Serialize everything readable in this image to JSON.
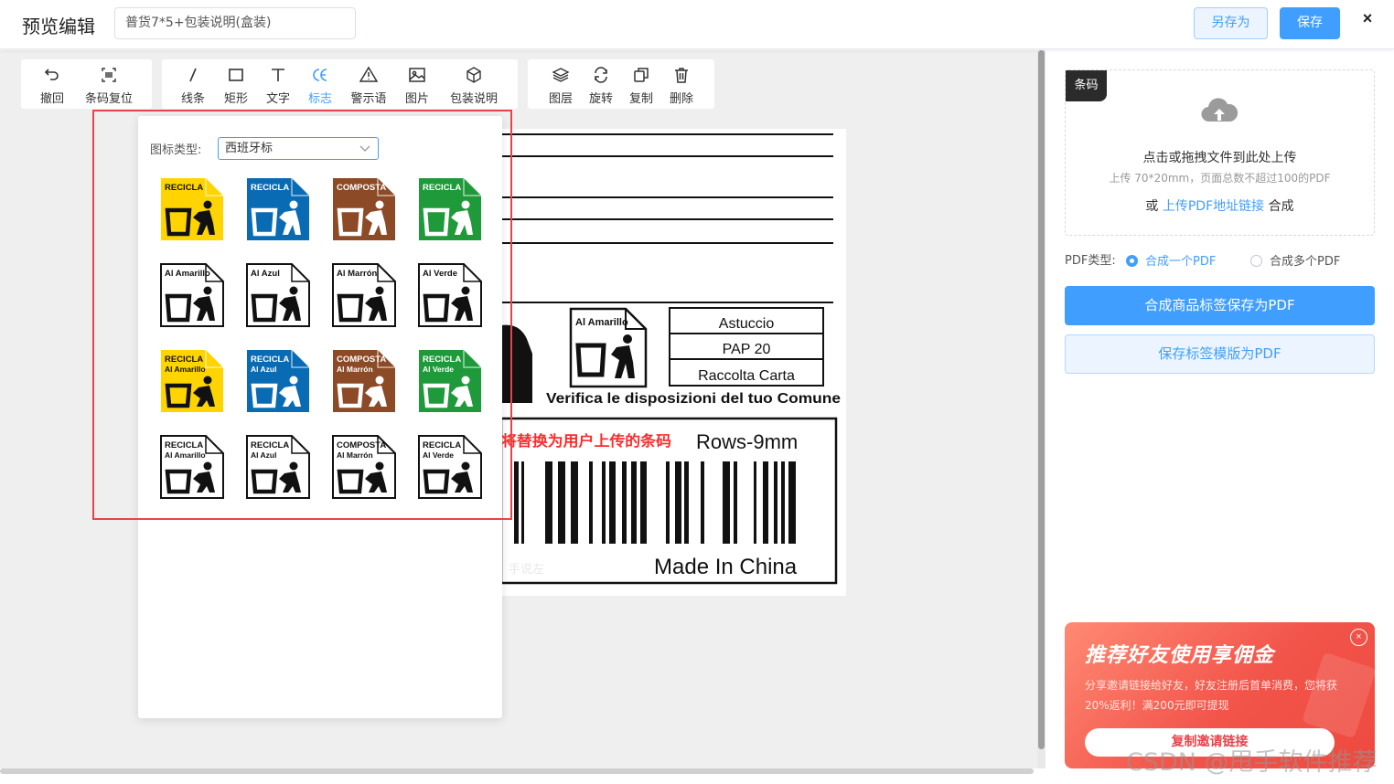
{
  "header": {
    "title": "预览编辑",
    "name_value": "普货7*5+包装说明(盒装)",
    "save_as_label": "另存为",
    "save_label": "保存",
    "close_label": "×"
  },
  "toolbar": {
    "group1": [
      {
        "name": "undo",
        "label": "撤回",
        "icon": "undo-icon"
      },
      {
        "name": "barcode-reset",
        "label": "条码复位",
        "icon": "barcode-reset-icon"
      }
    ],
    "group2": [
      {
        "name": "line",
        "label": "线条",
        "icon": "line-icon"
      },
      {
        "name": "rect",
        "label": "矩形",
        "icon": "rectangle-icon"
      },
      {
        "name": "text",
        "label": "文字",
        "icon": "text-icon"
      },
      {
        "name": "logo",
        "label": "标志",
        "icon": "ce-mark-icon",
        "active": true
      },
      {
        "name": "warning",
        "label": "警示语",
        "icon": "warning-icon"
      },
      {
        "name": "image",
        "label": "图片",
        "icon": "image-icon"
      },
      {
        "name": "package",
        "label": "包装说明",
        "icon": "package-icon"
      }
    ],
    "group3": [
      {
        "name": "layers",
        "label": "图层",
        "icon": "layers-icon"
      },
      {
        "name": "rotate",
        "label": "旋转",
        "icon": "rotate-icon"
      },
      {
        "name": "copy",
        "label": "复制",
        "icon": "copy-icon"
      },
      {
        "name": "delete",
        "label": "删除",
        "icon": "trash-icon"
      }
    ]
  },
  "icon_panel": {
    "type_label": "图标类型:",
    "type_value": "西班牙标",
    "icons": [
      {
        "top": "RECICLA",
        "sub": "",
        "color": "#ffd400",
        "text_color": "#111111"
      },
      {
        "top": "RECICLA",
        "sub": "",
        "color": "#0a6bb5",
        "text_color": "#ffffff"
      },
      {
        "top": "COMPOSTA",
        "sub": "",
        "color": "#8c4a26",
        "text_color": "#ffffff"
      },
      {
        "top": "RECICLA",
        "sub": "",
        "color": "#1f9a3a",
        "text_color": "#ffffff"
      },
      {
        "top": "Al Amarillo",
        "sub": "",
        "color": "#ffffff",
        "text_color": "#111111"
      },
      {
        "top": "Al Azul",
        "sub": "",
        "color": "#ffffff",
        "text_color": "#111111"
      },
      {
        "top": "Al Marrón",
        "sub": "",
        "color": "#ffffff",
        "text_color": "#111111"
      },
      {
        "top": "Al Verde",
        "sub": "",
        "color": "#ffffff",
        "text_color": "#111111"
      },
      {
        "top": "RECICLA",
        "sub": "Al Amarillo",
        "color": "#ffd400",
        "text_color": "#111111"
      },
      {
        "top": "RECICLA",
        "sub": "Al Azul",
        "color": "#0a6bb5",
        "text_color": "#ffffff"
      },
      {
        "top": "COMPOSTA",
        "sub": "Al Marrón",
        "color": "#8c4a26",
        "text_color": "#ffffff"
      },
      {
        "top": "RECICLA",
        "sub": "Al Verde",
        "color": "#1f9a3a",
        "text_color": "#ffffff"
      },
      {
        "top": "RECICLA",
        "sub": "Al Amarillo",
        "color": "#ffffff",
        "text_color": "#111111"
      },
      {
        "top": "RECICLA",
        "sub": "Al Azul",
        "color": "#ffffff",
        "text_color": "#111111"
      },
      {
        "top": "COMPOSTA",
        "sub": "Al Marrón",
        "color": "#ffffff",
        "text_color": "#111111"
      },
      {
        "top": "RECICLA",
        "sub": "Al Verde",
        "color": "#ffffff",
        "text_color": "#111111"
      }
    ]
  },
  "label": {
    "icon_text": "Al Amarillo",
    "table": [
      "Astuccio",
      "PAP 20",
      "Raccolta Carta"
    ],
    "verify_text": "Verifica le disposizioni del tuo Comune",
    "barcode_hint": "将替换为用户上传的条码",
    "rows_text": "Rows-9mm",
    "made_in": "Made In China",
    "faint_text": "手说左"
  },
  "right": {
    "badge": "条码",
    "upload_main": "点击或拖拽文件到此处上传",
    "upload_sub": "上传 70*20mm，页面总数不超过100的PDF",
    "upload_or": "或",
    "upload_link": "上传PDF地址链接",
    "upload_after": "合成",
    "pdf_type_label": "PDF类型:",
    "radio_one": "合成一个PDF",
    "radio_many": "合成多个PDF",
    "btn_save_pdf": "合成商品标签保存为PDF",
    "btn_save_template": "保存标签模版为PDF"
  },
  "promo": {
    "title": "推荐好友使用享佣金",
    "text": "分享邀请链接给好友，好友注册后首单消费，您将获20%返利！满200元即可提现",
    "button": "复制邀请链接",
    "close": "×"
  },
  "watermark": "CSDN @甩手软件推荐",
  "colors": {
    "accent": "#409eff",
    "highlight": "#e8434a",
    "barcode_hint": "#ff2a2a"
  }
}
